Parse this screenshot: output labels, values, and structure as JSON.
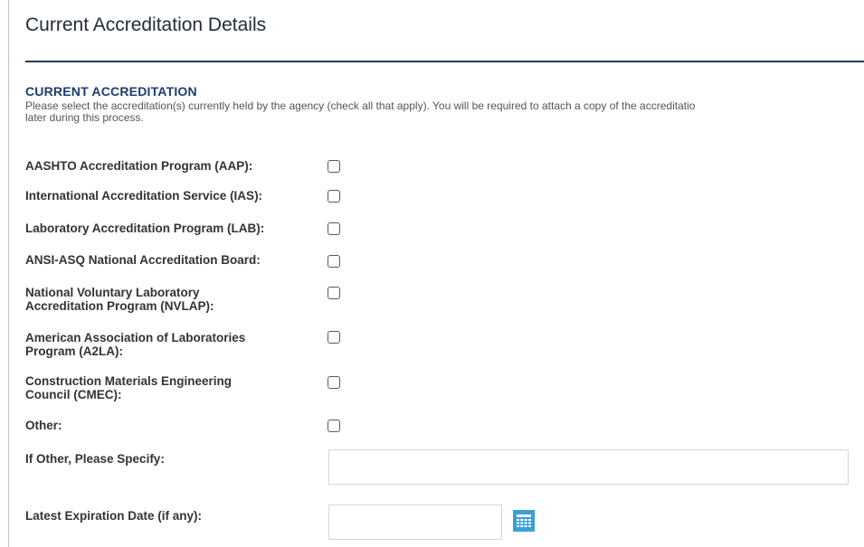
{
  "page": {
    "title": "Current Accreditation Details"
  },
  "section": {
    "heading": "CURRENT ACCREDITATION",
    "instructions_line1": "Please select the accreditation(s) currently held by the agency (check all that apply). You will be required to attach a copy of the accreditatio",
    "instructions_line2": "later during this process."
  },
  "accreditations": [
    {
      "label_line1": "AASHTO Accreditation Program (AAP):",
      "label_line2": "",
      "checked": false
    },
    {
      "label_line1": "International Accreditation Service (IAS):",
      "label_line2": "",
      "checked": false
    },
    {
      "label_line1": "Laboratory Accreditation Program (LAB):",
      "label_line2": "",
      "checked": false
    },
    {
      "label_line1": "ANSI-ASQ National Accreditation Board:",
      "label_line2": "",
      "checked": false
    },
    {
      "label_line1": "National Voluntary Laboratory",
      "label_line2": "Accreditation Program (NVLAP):",
      "checked": false
    },
    {
      "label_line1": "American Association of Laboratories",
      "label_line2": "Program (A2LA):",
      "checked": false
    },
    {
      "label_line1": "Construction Materials Engineering",
      "label_line2": "Council (CMEC):",
      "checked": false
    },
    {
      "label_line1": "Other:",
      "label_line2": "",
      "checked": false
    }
  ],
  "other_specify": {
    "label": "If Other, Please Specify:",
    "value": ""
  },
  "expiration": {
    "label": "Latest Expiration Date (if any):",
    "value": ""
  },
  "icons": {
    "calendar": "calendar-icon"
  },
  "colors": {
    "heading": "#1b3d6e",
    "rule": "#243b55",
    "calendar": "#3aa0d8"
  }
}
